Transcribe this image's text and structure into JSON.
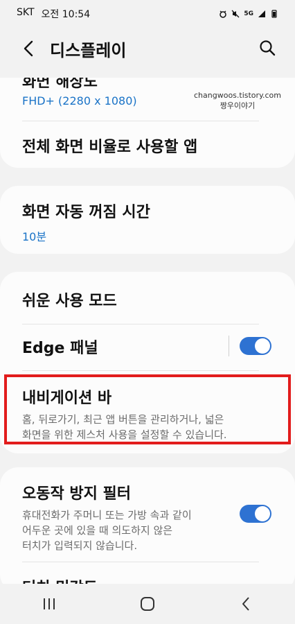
{
  "status": {
    "carrier": "SKT",
    "time": "오전 10:54",
    "network": "5G"
  },
  "header": {
    "title": "디스플레이",
    "back_icon": "back-arrow-icon",
    "search_icon": "search-icon"
  },
  "watermark": {
    "line1": "changwoos.tistory.com",
    "line2": "짱우이야기"
  },
  "card1": {
    "resolution_title": "화면 해상도",
    "resolution_value": "FHD+ (2280 x 1080)",
    "fullscreen_apps_title": "전체 화면 비율로 사용할 앱"
  },
  "card2": {
    "timeout_title": "화면 자동 꺼짐 시간",
    "timeout_value": "10분"
  },
  "card3": {
    "easy_mode_title": "쉬운 사용 모드",
    "edge_panel_title": "Edge 패널",
    "edge_panel_enabled": true,
    "nav_bar_title": "내비게이션 바",
    "nav_bar_desc_line1": "홈, 뒤로가기, 최근 앱 버튼을 관리하거나, 넓은",
    "nav_bar_desc_line2": "화면을 위한 제스처 사용을 설정할 수 있습니다."
  },
  "card4": {
    "accidental_touch_title": "오동작 방지 필터",
    "accidental_touch_desc_line1": "휴대전화가 주머니 또는 가방 속과 같이",
    "accidental_touch_desc_line2": "어두운 곳에 있을 때 의도하지 않은",
    "accidental_touch_desc_line3": "터치가 입력되지 않습니다.",
    "accidental_touch_enabled": true,
    "next_title_partial": "터치 민감도"
  },
  "colors": {
    "accent": "#2e72d2",
    "link": "#1a73c7",
    "highlight": "#e21c1c"
  }
}
